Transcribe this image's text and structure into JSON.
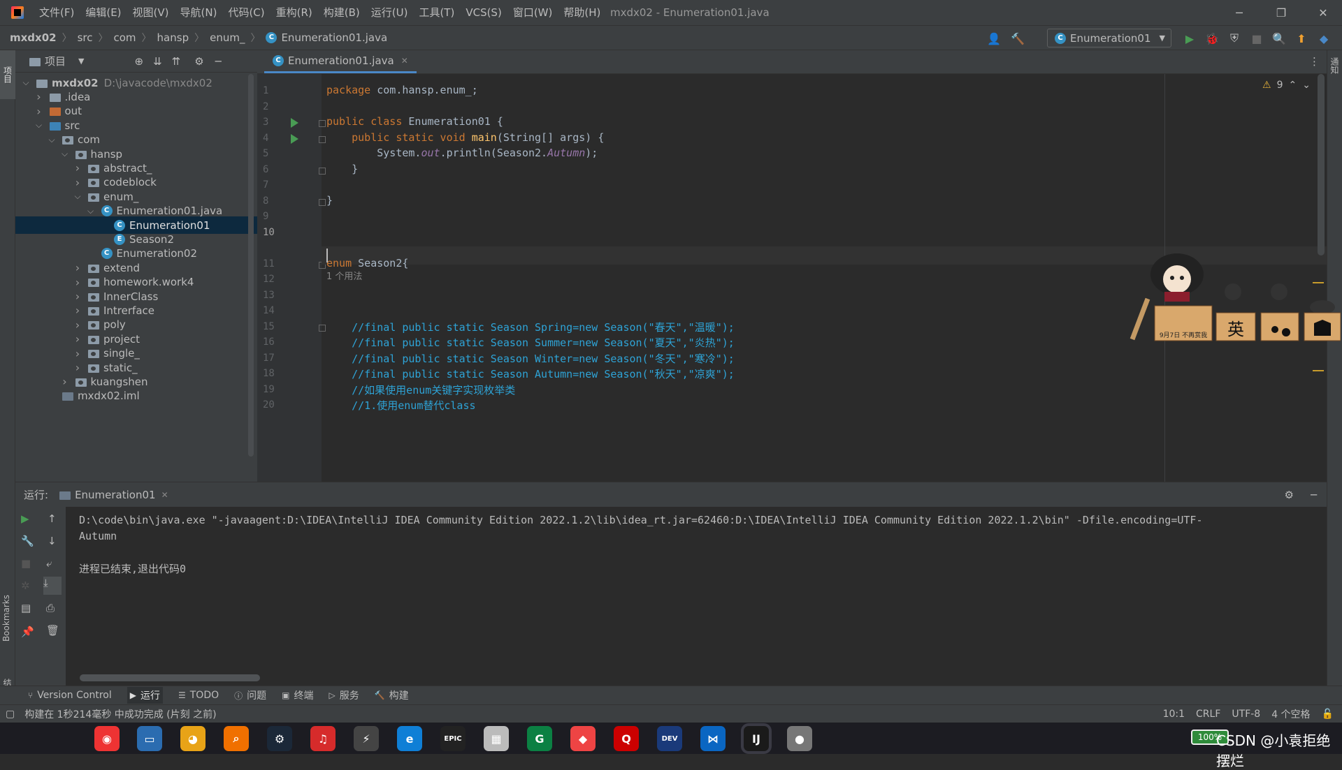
{
  "menu": [
    "文件(F)",
    "编辑(E)",
    "视图(V)",
    "导航(N)",
    "代码(C)",
    "重构(R)",
    "构建(B)",
    "运行(U)",
    "工具(T)",
    "VCS(S)",
    "窗口(W)",
    "帮助(H)"
  ],
  "window_title": "mxdx02 - Enumeration01.java",
  "breadcrumb": [
    "mxdx02",
    "src",
    "com",
    "hansp",
    "enum_",
    "Enumeration01.java"
  ],
  "run_config": "Enumeration01",
  "left_strip_label": "项目",
  "bookmarks_label": "Bookmarks",
  "structure_label": "结构",
  "right_strip_label": "通知",
  "project_panel": {
    "title": "项目",
    "tree": [
      {
        "label": "mxdx02",
        "path": "D:\\javacode\\mxdx02",
        "depth": 0,
        "expanded": true,
        "icon": "module"
      },
      {
        "label": ".idea",
        "depth": 1,
        "expanded": false,
        "icon": "folder"
      },
      {
        "label": "out",
        "depth": 1,
        "expanded": false,
        "icon": "folder-orange"
      },
      {
        "label": "src",
        "depth": 1,
        "expanded": true,
        "icon": "folder-blue"
      },
      {
        "label": "com",
        "depth": 2,
        "expanded": true,
        "icon": "package"
      },
      {
        "label": "hansp",
        "depth": 3,
        "expanded": true,
        "icon": "package"
      },
      {
        "label": "abstract_",
        "depth": 4,
        "expanded": false,
        "icon": "package"
      },
      {
        "label": "codeblock",
        "depth": 4,
        "expanded": false,
        "icon": "package"
      },
      {
        "label": "enum_",
        "depth": 4,
        "expanded": true,
        "icon": "package"
      },
      {
        "label": "Enumeration01.java",
        "depth": 5,
        "expanded": true,
        "icon": "java-file"
      },
      {
        "label": "Enumeration01",
        "depth": 6,
        "icon": "class",
        "selected": true
      },
      {
        "label": "Season2",
        "depth": 6,
        "icon": "enum"
      },
      {
        "label": "Enumeration02",
        "depth": 5,
        "icon": "class"
      },
      {
        "label": "extend",
        "depth": 4,
        "expanded": false,
        "icon": "package"
      },
      {
        "label": "homework.work4",
        "depth": 4,
        "expanded": false,
        "icon": "package"
      },
      {
        "label": "InnerClass",
        "depth": 4,
        "expanded": false,
        "icon": "package"
      },
      {
        "label": "Intrerface",
        "depth": 4,
        "expanded": false,
        "icon": "package"
      },
      {
        "label": "poly",
        "depth": 4,
        "expanded": false,
        "icon": "package"
      },
      {
        "label": "project",
        "depth": 4,
        "expanded": false,
        "icon": "package"
      },
      {
        "label": "single_",
        "depth": 4,
        "expanded": false,
        "icon": "package"
      },
      {
        "label": "static_",
        "depth": 4,
        "expanded": false,
        "icon": "package"
      },
      {
        "label": "kuangshen",
        "depth": 3,
        "expanded": false,
        "icon": "package"
      },
      {
        "label": "mxdx02.iml",
        "depth": 2,
        "icon": "iml"
      }
    ]
  },
  "editor": {
    "tab": "Enumeration01.java",
    "warnings": "9",
    "usage_hint": "1 个用法",
    "lines": [
      {
        "n": "1",
        "html": "<span class='kw'>package</span> com.hansp.enum_;"
      },
      {
        "n": "2",
        "html": ""
      },
      {
        "n": "3",
        "html": "<span class='kw'>public class</span> Enumeration01 {",
        "run": true
      },
      {
        "n": "4",
        "html": "    <span class='kw'>public static void</span> <span class='fn'>main</span>(String[] args) {",
        "run": true
      },
      {
        "n": "5",
        "html": "        System.<span class='it'>out</span>.println(Season2.<span class='it'>Autumn</span>);"
      },
      {
        "n": "6",
        "html": "    }"
      },
      {
        "n": "7",
        "html": ""
      },
      {
        "n": "8",
        "html": "}"
      },
      {
        "n": "9",
        "html": ""
      },
      {
        "n": "10",
        "html": ""
      },
      {
        "n": "11",
        "html": "<span class='kw'>enum</span> Season2{"
      },
      {
        "n": "12",
        "html": ""
      },
      {
        "n": "13",
        "html": ""
      },
      {
        "n": "14",
        "html": ""
      },
      {
        "n": "15",
        "html": "    <span class='cm'>//final public static Season Spring=new Season(\"春天\",\"温暖\");</span>"
      },
      {
        "n": "16",
        "html": "    <span class='cm'>//final public static Season Summer=new Season(\"夏天\",\"炎热\");</span>"
      },
      {
        "n": "17",
        "html": "    <span class='cm'>//final public static Season Winter=new Season(\"冬天\",\"寒冷\");</span>"
      },
      {
        "n": "18",
        "html": "    <span class='cm'>//final public static Season Autumn=new Season(\"秋天\",\"凉爽\");</span>"
      },
      {
        "n": "19",
        "html": "    <span class='cm'>//如果使用enum关键字实现枚举类</span>"
      },
      {
        "n": "20",
        "html": "    <span class='cm'>//1.使用enum替代class</span>"
      }
    ]
  },
  "sticker": {
    "badge_text": "9月7日 不再赏我",
    "tile_text": "英"
  },
  "run_panel": {
    "label": "运行:",
    "tab": "Enumeration01",
    "output": [
      "D:\\code\\bin\\java.exe \"-javaagent:D:\\IDEA\\IntelliJ IDEA Community Edition 2022.1.2\\lib\\idea_rt.jar=62460:D:\\IDEA\\IntelliJ IDEA Community Edition 2022.1.2\\bin\" -Dfile.encoding=UTF-",
      "Autumn",
      "",
      "进程已结束,退出代码0"
    ]
  },
  "bottom_tools": [
    "Version Control",
    "运行",
    "TODO",
    "问题",
    "终端",
    "服务",
    "构建"
  ],
  "status": {
    "message": "构建在 1秒214毫秒 中成功完成 (片刻 之前)",
    "position": "10:1",
    "line_sep": "CRLF",
    "encoding": "UTF-8",
    "indent": "4 个空格"
  },
  "taskbar": {
    "watermark": "CSDN @小袁拒绝摆烂",
    "battery": "100%",
    "apps": [
      "Chrome",
      "Desktop",
      "Baidu",
      "Everything",
      "Steam",
      "NetEase Music",
      "Mail",
      "Edge",
      "Epic Games",
      "Image",
      "Grammarly",
      "Git",
      "QQ",
      "Dev-C++",
      "VS Code",
      "IntelliJ IDEA",
      "Avatar"
    ]
  },
  "colors": {
    "accent": "#4a88c7",
    "keyword": "#cc7832",
    "function": "#ffc66d",
    "comment": "#2ea3d6",
    "static_field": "#9876aa",
    "run_green": "#499c54"
  }
}
